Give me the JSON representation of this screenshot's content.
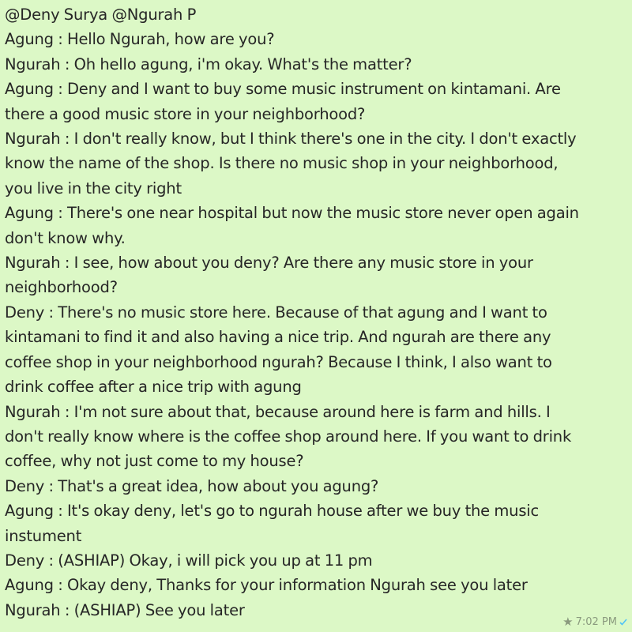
{
  "chat": {
    "mentions": "@Deny Surya @Ngurah P",
    "messages": [
      "Agung : Hello Ngurah, how are you?",
      "Ngurah : Oh hello agung, i'm okay. What's the matter?",
      "Agung : Deny and I want to buy some music instrument on kintamani. Are\nthere a good music store in your neighborhood?",
      "Ngurah : I don't really know, but I think there's one in the city. I don't exactly\nknow the name of the shop. Is there no music shop in your neighborhood,\nyou live in the city right",
      "Agung : There's one near hospital but now the music store never open again\ndon't know why.",
      "Ngurah : I see, how about you deny? Are there any music store in your\nneighborhood?",
      "Deny : There's no music store here. Because of that agung and I want to\nkintamani to find it and also having a nice trip. And ngurah are there any\ncoffee shop in your neighborhood ngurah? Because I think, I also want to\ndrink coffee after a nice trip with agung",
      "Ngurah : I'm not sure about that, because around here is farm and hills. I\ndon't really know where is the coffee shop around here. If you want to drink\ncoffee, why not just come to my house?",
      "Deny : That's a great idea, how about you agung?",
      "Agung : It's okay deny, let's go to ngurah house after we buy the music\ninstument",
      "Deny : (ASHIAP) Okay, i will pick you up at 11 pm",
      "Agung : Okay deny, Thanks for your information Ngurah see you later",
      "Ngurah : (ASHIAP) See you later"
    ],
    "time": "7:02 PM",
    "star_icon": "star-icon",
    "status_icon": "check-icon",
    "colors": {
      "background": "#dcf8c6",
      "text": "#262626",
      "meta": "#8a9a7e",
      "check": "#4fc3f7"
    }
  }
}
